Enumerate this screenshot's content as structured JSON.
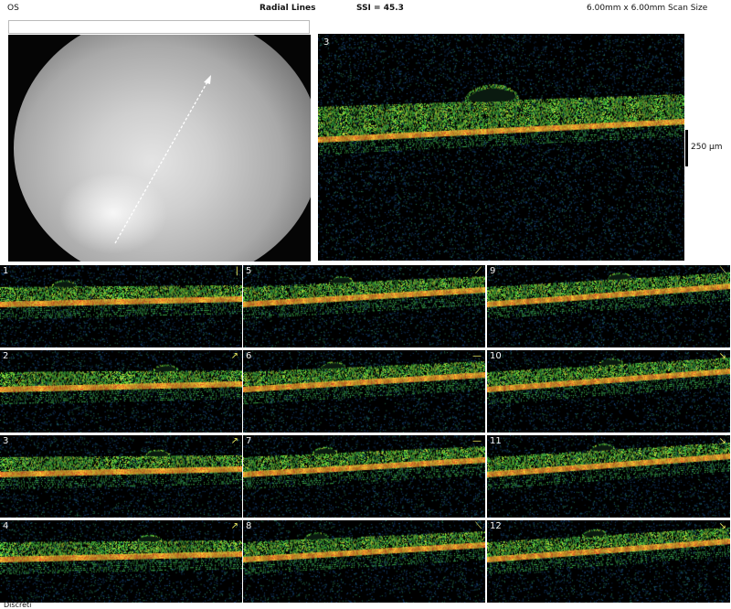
{
  "header": {
    "eye": "OS",
    "mode": "Radial Lines",
    "ssi": "SSI = 45.3",
    "scan_size": "6.00mm x 6.00mm Scan Size"
  },
  "main_scan": {
    "number": "3"
  },
  "scale": {
    "label": "250 µm"
  },
  "thumbnails": [
    {
      "number": "1",
      "indicator": "|"
    },
    {
      "number": "5",
      "indicator": "⟋"
    },
    {
      "number": "9",
      "indicator": "⟍"
    },
    {
      "number": "2",
      "indicator": "↗"
    },
    {
      "number": "6",
      "indicator": "—"
    },
    {
      "number": "10",
      "indicator": "↘"
    },
    {
      "number": "3",
      "indicator": "↗"
    },
    {
      "number": "7",
      "indicator": "—"
    },
    {
      "number": "11",
      "indicator": "↘"
    },
    {
      "number": "4",
      "indicator": "↗"
    },
    {
      "number": "8",
      "indicator": "⟍"
    },
    {
      "number": "12",
      "indicator": "↘"
    }
  ],
  "footer": {
    "label": "Discreti"
  },
  "colors": {
    "bg": "#000000",
    "rpe": "#f2a12c",
    "retina": "#58d23a",
    "noise": "#1f6fb0"
  }
}
